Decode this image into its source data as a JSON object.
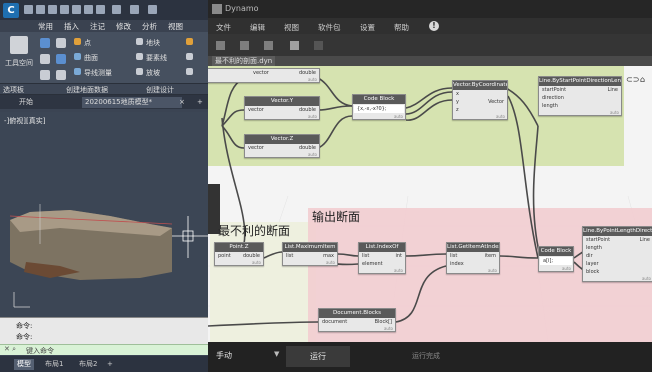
{
  "cad": {
    "logo": "C",
    "menus": [
      "常用",
      "插入",
      "注记",
      "修改",
      "分析",
      "视图"
    ],
    "ribbon": {
      "big_button": "工具空间",
      "items": [
        "点",
        "曲面",
        "地块",
        "要素线",
        "放坡",
        "导线测量"
      ],
      "panels": [
        "选项板",
        "创建地面数据",
        "创建设计"
      ]
    },
    "tabs": {
      "start": "开始",
      "drawing": "20200615地质模型*",
      "close": "×",
      "add": "+"
    },
    "view_control": "-]俯视][真实]",
    "command_history": [
      "命令:",
      "命令:"
    ],
    "command_prompt": "键入命令",
    "layout_tabs": [
      "模型",
      "布局1",
      "布局2"
    ]
  },
  "dynamo": {
    "window_title": "Dynamo",
    "menus": [
      "文件",
      "编辑",
      "视图",
      "软件包",
      "设置",
      "帮助"
    ],
    "help_glyph": "!",
    "file_tab": "最不利的剖面.dyn",
    "groups": {
      "worst_section": "最不利的断面",
      "output_section": "输出断面"
    },
    "nodes": {
      "vector_x": {
        "title": "Vector.X",
        "in": "vector",
        "out": "double"
      },
      "vector_y": {
        "title": "Vector.Y",
        "in": "vector",
        "out": "double"
      },
      "vector_z": {
        "title": "Vector.Z",
        "in": "vector",
        "out": "double"
      },
      "top_left": {
        "in": "vector",
        "out": "double"
      },
      "code_block_1": {
        "title": "Code Block",
        "code": "{x,-x,-x?0};"
      },
      "by_coordinates": {
        "title": "Vector.ByCoordinates",
        "in": [
          "x",
          "y",
          "z"
        ],
        "out": "Vector"
      },
      "line_start_dir": {
        "title": "Line.ByStartPointDirectionLength",
        "in": [
          "startPoint",
          "direction",
          "length"
        ],
        "out": "Line"
      },
      "point_z": {
        "title": "Point.Z",
        "in": "point",
        "out": "double"
      },
      "list_max": {
        "title": "List.MaximumItem",
        "in": "list",
        "out": "max"
      },
      "list_indexof": {
        "title": "List.IndexOf",
        "in": [
          "list",
          "element"
        ],
        "out": "int"
      },
      "get_item": {
        "title": "List.GetItemAtIndex",
        "in": [
          "list",
          "index"
        ],
        "out": "item"
      },
      "code_block_2": {
        "title": "Code Block",
        "code": "a[i];"
      },
      "line_point_len": {
        "title": "Line.ByPointLengthDirection",
        "in": [
          "startPoint",
          "length",
          "dir",
          "layer",
          "block"
        ],
        "out": "Line"
      },
      "doc_blocks": {
        "title": "Document.Blocks",
        "in": "document",
        "out": "Block[]"
      }
    },
    "run_mode": "手动",
    "run_button": "运行",
    "run_status": "运行完成"
  }
}
